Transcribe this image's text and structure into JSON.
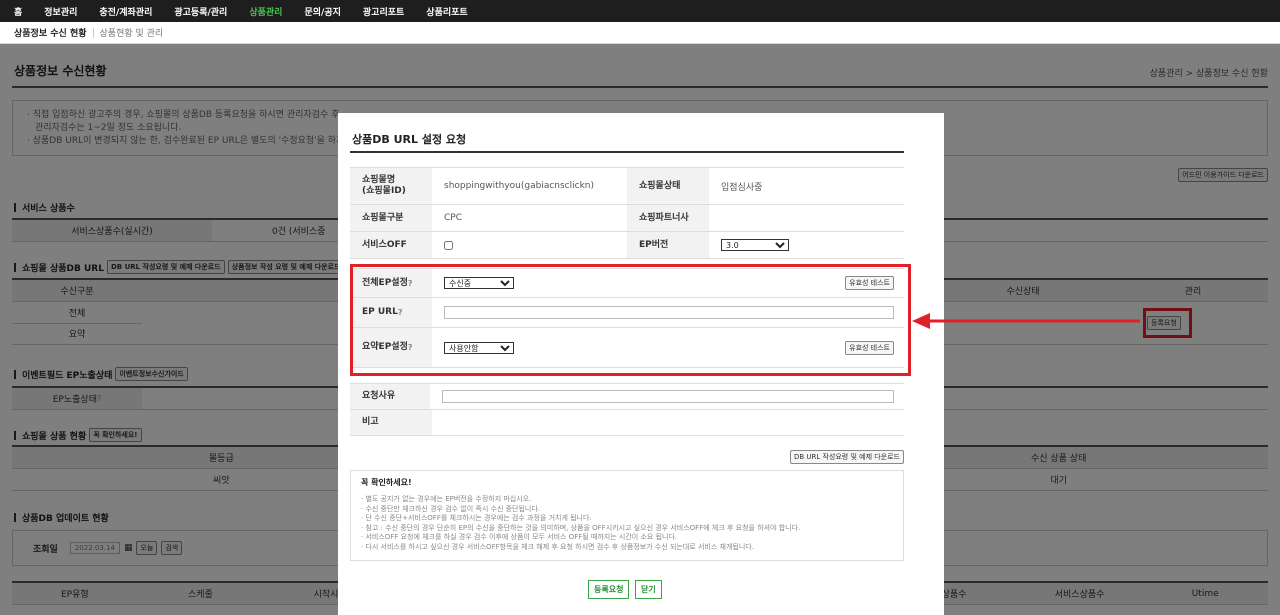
{
  "gnb": {
    "items": [
      "홈",
      "정보관리",
      "충전/계좌관리",
      "광고등록/관리",
      "상품관리",
      "문의/공지",
      "광고리포트",
      "상품리포트"
    ],
    "active": 4
  },
  "sub": {
    "current": "상품정보 수신 현황",
    "other": "상품현황 및 관리"
  },
  "page": {
    "title": "상품정보 수신현황",
    "breadcrumb": "상품관리 > 상품정보 수신 현황",
    "notice": [
      "· 직접 입점하신 광고주의 경우, 쇼핑몰의 상품DB 등록요청을 하시면 관리자검수 후 ...",
      "관리자검수는 1~2일 정도 소요됩니다.",
      "· 상품DB URL이 변경되지 않는 한, 검수완료된 EP URL은 별도의 '수정요청'을 하지 않..."
    ],
    "guide_btn": "어드민 이용가이드 다운로드",
    "sec_service": "서비스 상품수",
    "service_label": "서비스상품수(실시간)",
    "service_value": "0건 (서비스중",
    "sec_dburl": "쇼핑몰 상품DB URL",
    "dburl_btn1": "DB URL 작성요령 및 예제 다운로드",
    "dburl_btn2": "상품정보 작성 요령 및 예제 다운로드",
    "col_recv_type": "수신구분",
    "col_recv_status": "수신상태",
    "col_manage": "관리",
    "row_all": "전체",
    "row_summary": "요약",
    "sec_event": "이벤트필드 EP노출상태",
    "event_btn": "이벤트정보수신가이드",
    "ep_status_label": "EP노출상태",
    "sec_goods": "쇼핑몰 상품 현황",
    "goods_btn": "꼭 확인하세요!",
    "col_grade": "몰등급",
    "grade_value": "씨앗",
    "col_goods_status": "수신 상품 상태",
    "goods_status_value": "대기",
    "sec_update": "상품DB 업데이트 현황",
    "search_label": "조회일",
    "search_date": "2022.03.14",
    "today_btn": "오늘",
    "search_btn": "검색",
    "col_ep": "EP유형",
    "col_schedule": "스케줄",
    "col_start": "시작시",
    "col_goods_cnt": "상품수",
    "col_service_cnt": "서비스상품수",
    "col_utime": "Utime",
    "register_btn": "등록요청"
  },
  "modal": {
    "title": "상품DB URL 설정 요청",
    "mall_name_label": "쇼핑몰명\n(쇼핑몰ID)",
    "mall_name_value": "shoppingwithyou(gabiacnsclickn)",
    "mall_status_label": "쇼핑몰상태",
    "mall_status_value": "입점심사중",
    "mall_type_label": "쇼핑몰구분",
    "mall_type_value": "CPC",
    "partner_label": "쇼핑파트너사",
    "partner_value": "",
    "service_off_label": "서비스OFF",
    "ep_version_label": "EP버전",
    "ep_version_value": "3.0",
    "full_ep_label": "전체EP설정",
    "full_ep_value": "수신중",
    "validate_btn": "유효성 테스트",
    "ep_url_label": "EP URL",
    "ep_url_value": "",
    "summary_ep_label": "요약EP설정",
    "summary_ep_value": "사용안함",
    "reason_label": "요청사유",
    "reason_value": "",
    "note_label": "비고",
    "download_btn": "DB URL 작성요령 및 예제 다운로드",
    "confirm_title": "꼭 확인하세요!",
    "confirm_lines": [
      "· 별도 공지가 없는 경우에는 EP버전을 수정하지 마십시오.",
      "· 수신 중단만 체크하신 경우 검수 없이 즉시 수신 중단됩니다.",
      "· 단 수신 중단+서비스OFF를 체크하시는 경우에는 검수 과정을 거치게 됩니다.",
      "· 참고 : 수신 중단의 경우 단순히 EP의 수신을 중단하는 것을 의미하며, 상품을 OFF시키시고 싶으신 경우 서비스OFF에 체크 후 요청을 하셔야 합니다.",
      "· 서비스OFF 요청에 체크를 하실 경우 검수 이후에 상품이 모두 서비스 OFF될 때까지는 시간이 소요 됩니다.",
      "· 다시 서비스를 하시고 싶으신 경우 서비스OFF항목을 체크 해제 후 요청 하시면 검수 후 상품정보가 수신 되는대로 서비스 재개됩니다."
    ],
    "submit_btn": "등록요청",
    "close_btn": "닫기",
    "help_mark": "?"
  },
  "colors": {
    "highlight": "#e0212a",
    "active_menu": "#49c94f",
    "button_green": "#3aa64a"
  }
}
